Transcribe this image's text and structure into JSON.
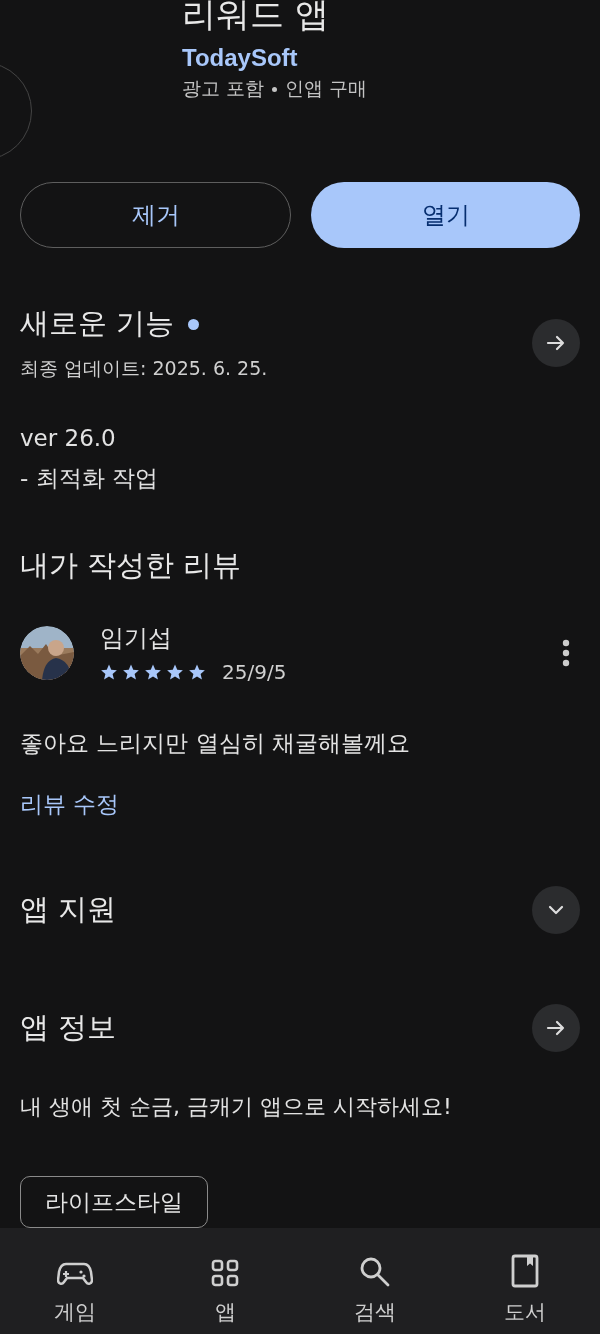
{
  "app": {
    "title": "리워드 앱",
    "developer": "TodaySoft",
    "meta": [
      "광고 포함",
      "인앱 구매"
    ]
  },
  "buttons": [
    {
      "label": "제거",
      "kind": "outline"
    },
    {
      "label": "열기",
      "kind": "filled"
    }
  ],
  "whats_new": {
    "title": "새로운 기능",
    "new_dot": true,
    "updated": "최종 업데이트: 2025. 6. 25.",
    "lines": [
      "ver 26.0",
      "- 최적화 작업"
    ]
  },
  "my_review": {
    "title": "내가 작성한 리뷰",
    "author": "임기섭",
    "stars": 5,
    "date": "25/9/5",
    "text": "좋아요 느리지만 열심히 채굴해볼께요",
    "edit": "리뷰 수정"
  },
  "sections": [
    {
      "title": "앱 지원",
      "kind": "expand"
    },
    {
      "title": "앱 정보",
      "kind": "arrow"
    }
  ],
  "description": "내 생애 첫 순금, 금캐기 앱으로 시작하세요!",
  "tags": [
    "라이프스타일"
  ],
  "bottom_nav": [
    {
      "label": "게임",
      "kind": "game",
      "selected": false
    },
    {
      "label": "앱",
      "kind": "apps",
      "selected": false
    },
    {
      "label": "검색",
      "kind": "search",
      "selected": false
    },
    {
      "label": "도서",
      "kind": "book",
      "selected": false
    }
  ]
}
